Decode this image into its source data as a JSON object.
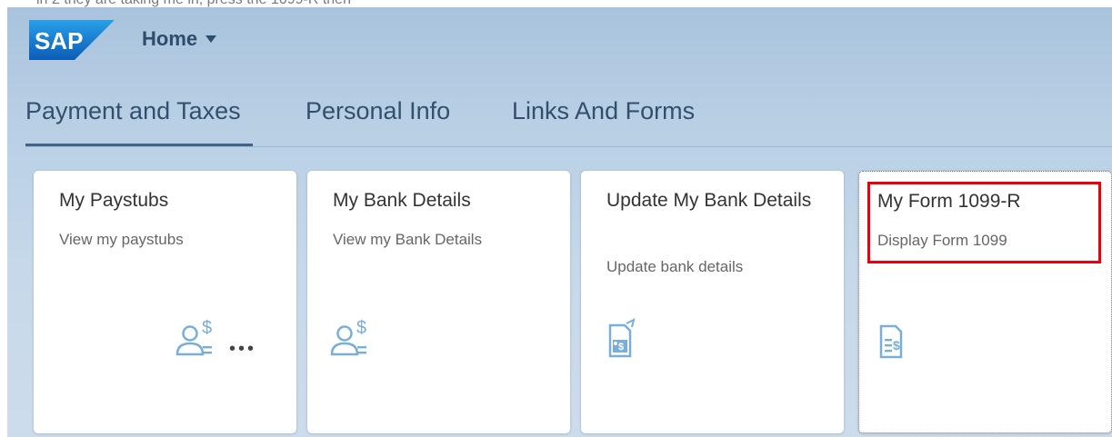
{
  "window": {
    "partial_caption": "in 2 they are taking me in, press the 1099-R then"
  },
  "shell": {
    "logo_text": "SAP",
    "home_label": "Home",
    "home_icon": "caret-down-icon"
  },
  "tabs": [
    {
      "label": "Payment and Taxes",
      "selected": true
    },
    {
      "label": "Personal Info",
      "selected": false
    },
    {
      "label": "Links And Forms",
      "selected": false
    }
  ],
  "tiles": [
    {
      "title": "My Paystubs",
      "subtitle": "View my paystubs",
      "icon": "person-dollar-icon",
      "has_more": true
    },
    {
      "title": "My Bank Details",
      "subtitle": "View my Bank Details",
      "icon": "person-dollar-icon"
    },
    {
      "title": "Update My Bank Details",
      "subtitle": "Update bank details",
      "icon": "bank-document-update-icon"
    },
    {
      "title": "My Form 1099-R",
      "subtitle": "Display Form 1099",
      "icon": "form-dollar-icon",
      "highlighted": true
    }
  ],
  "colors": {
    "accent": "#3f6488",
    "highlight": "#e8000e",
    "icon": "#7aaed6",
    "logo_blue": "#1b74c4"
  }
}
